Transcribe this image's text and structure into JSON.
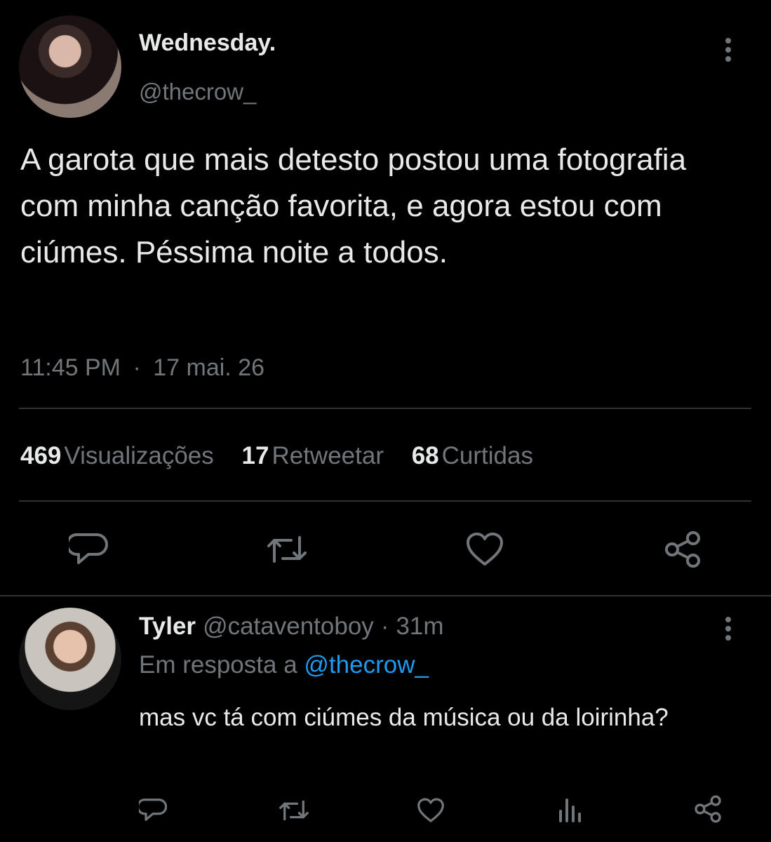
{
  "tweet": {
    "display_name": "Wednesday.",
    "handle": "@thecrow_",
    "text": "A garota que mais detesto postou uma fotografia com minha canção favorita, e agora estou com ciúmes. Péssima noite a todos.",
    "time": "11:45 PM",
    "separator": "·",
    "date": "17 mai. 26",
    "stats": {
      "views_count": "469",
      "views_label": "Visualizações",
      "retweets_count": "17",
      "retweets_label": "Retweetar",
      "likes_count": "68",
      "likes_label": "Curtidas"
    }
  },
  "reply": {
    "display_name": "Tyler",
    "handle": "@cataventoboy",
    "separator": "·",
    "age": "31m",
    "reply_prefix": "Em resposta a",
    "reply_to": "@thecrow_",
    "text": "mas vc tá com ciúmes da música ou da loirinha?"
  },
  "icons": {
    "main_actions": [
      "comment-icon",
      "retweet-icon",
      "heart-icon",
      "share-icon"
    ],
    "reply_actions": [
      "comment-icon",
      "retweet-icon",
      "heart-icon",
      "analytics-icon",
      "share-icon"
    ],
    "more": "more-icon"
  },
  "colors": {
    "background": "#000000",
    "text": "#e7e9ea",
    "muted": "#71767b",
    "link": "#1d9bf0",
    "divider": "#2f3336"
  }
}
